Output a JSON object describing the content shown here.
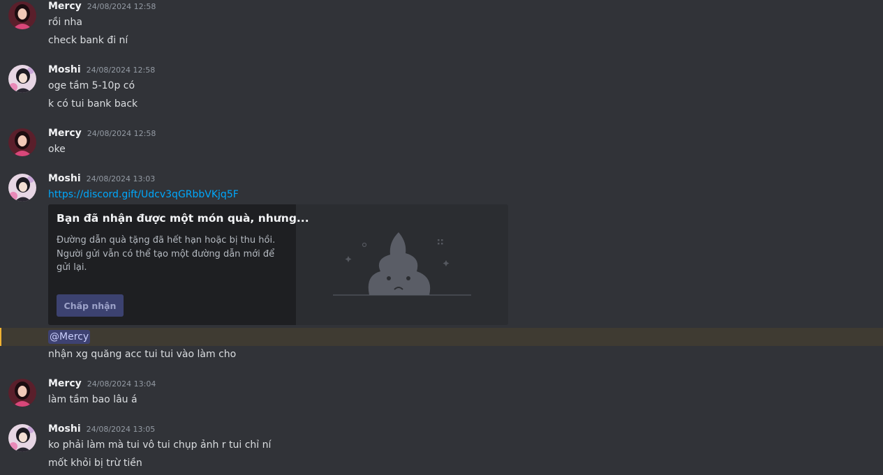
{
  "colors": {
    "background": "#313338",
    "link": "#00a8fc",
    "mention_highlight": "#3f3b32",
    "mention_pill": "#3e4272",
    "accept_button": "#3c4270"
  },
  "messages": [
    {
      "author": "Mercy",
      "timestamp": "24/08/2024 12:58",
      "avatar": "mercy-avatar",
      "lines": [
        "rồi nha",
        "check bank đi ní"
      ]
    },
    {
      "author": "Moshi",
      "timestamp": "24/08/2024 12:58",
      "avatar": "moshi-avatar",
      "lines": [
        "oge tầm 5-10p có",
        "k có tui bank back"
      ]
    },
    {
      "author": "Mercy",
      "timestamp": "24/08/2024 12:58",
      "avatar": "mercy-avatar",
      "lines": [
        "oke"
      ]
    },
    {
      "author": "Moshi",
      "timestamp": "24/08/2024 13:03",
      "avatar": "moshi-avatar",
      "link": "https://discord.gift/Udcv3qGRbbVKjq5F",
      "embed": {
        "title": "Bạn đã nhận được một món quà, nhưng...",
        "description": "Đường dẫn quà tặng đã hết hạn hoặc bị thu hồi. Người gửi vẫn có thể tạo một đường dẫn mới để gửi lại.",
        "button_label": "Chấp nhận",
        "illustration": "poop-icon"
      },
      "mention": "@Mercy",
      "after_mention": "nhận xg quăng acc tui tui vào làm cho"
    },
    {
      "author": "Mercy",
      "timestamp": "24/08/2024 13:04",
      "avatar": "mercy-avatar",
      "lines": [
        "làm tầm bao lâu á"
      ]
    },
    {
      "author": "Moshi",
      "timestamp": "24/08/2024 13:05",
      "avatar": "moshi-avatar",
      "lines": [
        "ko phải làm mà tui vô tui chụp ảnh r tui chỉ ní",
        "mốt khỏi bị trừ tiền"
      ]
    }
  ]
}
